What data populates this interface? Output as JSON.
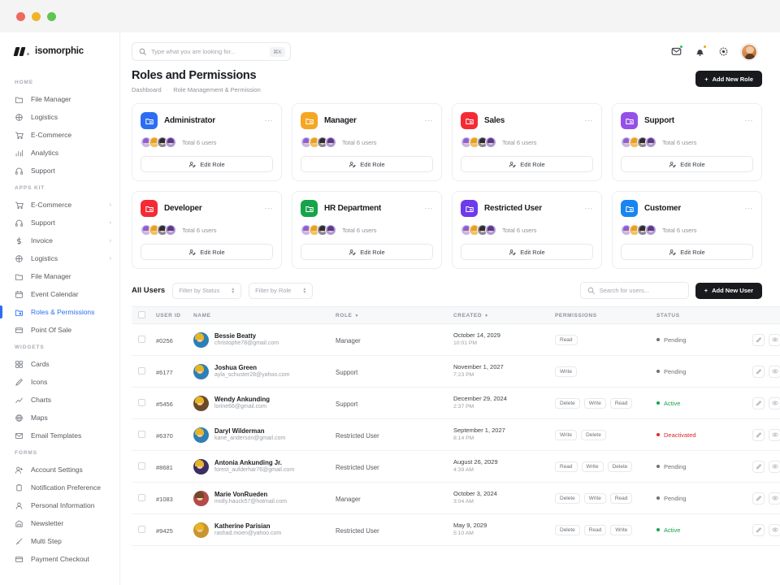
{
  "window": {
    "traffic_lights": [
      "close",
      "minimize",
      "maximize"
    ]
  },
  "brand": {
    "name": "isomorphic"
  },
  "sidebar": {
    "sections": [
      {
        "title": "HOME",
        "items": [
          {
            "label": "File Manager",
            "icon": "file-manager-icon",
            "chevron": false,
            "active": false
          },
          {
            "label": "Logistics",
            "icon": "logistics-icon",
            "chevron": false,
            "active": false
          },
          {
            "label": "E-Commerce",
            "icon": "cart-icon",
            "chevron": false,
            "active": false
          },
          {
            "label": "Analytics",
            "icon": "analytics-icon",
            "chevron": false,
            "active": false
          },
          {
            "label": "Support",
            "icon": "headset-icon",
            "chevron": false,
            "active": false
          }
        ]
      },
      {
        "title": "APPS KIT",
        "items": [
          {
            "label": "E-Commerce",
            "icon": "cart-icon",
            "chevron": true,
            "active": false
          },
          {
            "label": "Support",
            "icon": "headset-icon",
            "chevron": true,
            "active": false
          },
          {
            "label": "Invoice",
            "icon": "dollar-icon",
            "chevron": true,
            "active": false
          },
          {
            "label": "Logistics",
            "icon": "logistics-icon",
            "chevron": true,
            "active": false
          },
          {
            "label": "File Manager",
            "icon": "file-manager-icon",
            "chevron": false,
            "active": false
          },
          {
            "label": "Event Calendar",
            "icon": "calendar-icon",
            "chevron": false,
            "active": false
          },
          {
            "label": "Roles & Permissions",
            "icon": "roles-icon",
            "chevron": false,
            "active": true
          },
          {
            "label": "Point Of Sale",
            "icon": "pos-icon",
            "chevron": false,
            "active": false
          }
        ]
      },
      {
        "title": "WIDGETS",
        "items": [
          {
            "label": "Cards",
            "icon": "cards-icon",
            "chevron": false,
            "active": false
          },
          {
            "label": "Icons",
            "icon": "icons-icon",
            "chevron": false,
            "active": false
          },
          {
            "label": "Charts",
            "icon": "charts-icon",
            "chevron": false,
            "active": false
          },
          {
            "label": "Maps",
            "icon": "maps-icon",
            "chevron": false,
            "active": false
          },
          {
            "label": "Email Templates",
            "icon": "email-icon",
            "chevron": false,
            "active": false
          }
        ]
      },
      {
        "title": "FORMS",
        "items": [
          {
            "label": "Account Settings",
            "icon": "account-settings-icon",
            "chevron": false,
            "active": false
          },
          {
            "label": "Notification Preference",
            "icon": "notification-icon",
            "chevron": false,
            "active": false
          },
          {
            "label": "Personal Information",
            "icon": "person-icon",
            "chevron": false,
            "active": false
          },
          {
            "label": "Newsletter",
            "icon": "newsletter-icon",
            "chevron": false,
            "active": false
          },
          {
            "label": "Multi Step",
            "icon": "multistep-icon",
            "chevron": false,
            "active": false
          },
          {
            "label": "Payment Checkout",
            "icon": "payment-icon",
            "chevron": false,
            "active": false
          }
        ]
      }
    ]
  },
  "topbar": {
    "search": {
      "placeholder": "Type what you are looking for...",
      "shortcut": "⌘K",
      "icon": "search-icon"
    },
    "icons": [
      {
        "name": "messages-icon",
        "badge_color": "#22c55e"
      },
      {
        "name": "bell-icon",
        "badge_color": "#f59e0b"
      },
      {
        "name": "settings-icon",
        "badge_color": ""
      }
    ],
    "avatar": "user-avatar"
  },
  "page": {
    "title": "Roles and Permissions",
    "breadcrumb": {
      "root": "Dashboard",
      "separator": "·",
      "current": "Role Management & Permission"
    },
    "add_role_button": {
      "label": "Add New Role",
      "plus": "+"
    }
  },
  "roles": [
    {
      "name": "Administrator",
      "color": "#2c6ef2",
      "total": "Total 6 users",
      "edit_label": "Edit Role",
      "menu": "···"
    },
    {
      "name": "Manager",
      "color": "#f5a623",
      "total": "Total 6 users",
      "edit_label": "Edit Role",
      "menu": "···"
    },
    {
      "name": "Sales",
      "color": "#f42b35",
      "total": "Total 6 users",
      "edit_label": "Edit Role",
      "menu": "···"
    },
    {
      "name": "Support",
      "color": "#9450e8",
      "total": "Total 6 users",
      "edit_label": "Edit Role",
      "menu": "···"
    },
    {
      "name": "Developer",
      "color": "#f42b35",
      "total": "Total 6 users",
      "edit_label": "Edit Role",
      "menu": "···"
    },
    {
      "name": "HR Department",
      "color": "#17a34a",
      "total": "Total 6 users",
      "edit_label": "Edit Role",
      "menu": "···"
    },
    {
      "name": "Restricted User",
      "color": "#6d3aec",
      "total": "Total 6 users",
      "edit_label": "Edit Role",
      "menu": "···"
    },
    {
      "name": "Customer",
      "color": "#1886f0",
      "total": "Total 6 users",
      "edit_label": "Edit Role",
      "menu": "···"
    }
  ],
  "users_section": {
    "title": "All Users",
    "filter_status": {
      "label": "Filter by Status"
    },
    "filter_role": {
      "label": "Filter by Role"
    },
    "search": {
      "placeholder": "Search for users...",
      "icon": "search-icon"
    },
    "add_user_button": {
      "label": "Add New User",
      "plus": "+"
    }
  },
  "table": {
    "columns": [
      {
        "key": "checkbox",
        "label": ""
      },
      {
        "key": "user_id",
        "label": "USER ID",
        "sortable": false
      },
      {
        "key": "name",
        "label": "NAME",
        "sortable": false
      },
      {
        "key": "role",
        "label": "ROLE",
        "sortable": true
      },
      {
        "key": "created",
        "label": "CREATED",
        "sortable": true
      },
      {
        "key": "permissions",
        "label": "PERMISSIONS",
        "sortable": false
      },
      {
        "key": "status",
        "label": "STATUS",
        "sortable": false
      },
      {
        "key": "actions",
        "label": ""
      }
    ],
    "status_colors": {
      "Pending": "#6b7077",
      "Active": "#17a34a",
      "Deactivated": "#e0262d"
    },
    "row_actions": [
      {
        "name": "edit-row-icon"
      },
      {
        "name": "view-row-icon"
      },
      {
        "name": "delete-row-icon"
      }
    ],
    "rows": [
      {
        "user_id": "#0256",
        "name": "Bessie Beatty",
        "email": "christophe78@gmail.com",
        "role": "Manager",
        "date": "October 14, 2029",
        "time": "10:01 PM",
        "permissions": [
          "Read"
        ],
        "status": "Pending",
        "av_hair": "#e8b424",
        "av_body": "#2f7fb5"
      },
      {
        "user_id": "#6177",
        "name": "Joshua Green",
        "email": "ayla_schuster28@yahoo.com",
        "role": "Support",
        "date": "November 1, 2027",
        "time": "7:23 PM",
        "permissions": [
          "Write"
        ],
        "status": "Pending",
        "av_hair": "#e8b424",
        "av_body": "#2f7fb5"
      },
      {
        "user_id": "#5456",
        "name": "Wendy Ankunding",
        "email": "lorine66@gmail.com",
        "role": "Support",
        "date": "December 29, 2024",
        "time": "2:37 PM",
        "permissions": [
          "Delete",
          "Write",
          "Read"
        ],
        "status": "Active",
        "av_hair": "#e8b424",
        "av_body": "#6b4a2a"
      },
      {
        "user_id": "#6370",
        "name": "Daryl Wilderman",
        "email": "kane_anderson@gmail.com",
        "role": "Restricted User",
        "date": "September 1, 2027",
        "time": "8:14 PM",
        "permissions": [
          "Write",
          "Delete"
        ],
        "status": "Deactivated",
        "av_hair": "#e8b424",
        "av_body": "#2f7fb5"
      },
      {
        "user_id": "#8681",
        "name": "Antonia Ankunding Jr.",
        "email": "forest_aufderhar76@gmail.com",
        "role": "Restricted User",
        "date": "August 26, 2029",
        "time": "4:39 AM",
        "permissions": [
          "Read",
          "Write",
          "Delete"
        ],
        "status": "Pending",
        "av_hair": "#e8b424",
        "av_body": "#3b2f63"
      },
      {
        "user_id": "#1083",
        "name": "Marie VonRueden",
        "email": "molly.hauck57@hotmail.com",
        "role": "Manager",
        "date": "October 3, 2024",
        "time": "3:04 AM",
        "permissions": [
          "Delete",
          "Write",
          "Read"
        ],
        "status": "Pending",
        "av_hair": "#6b4a2a",
        "av_body": "#b44a4a"
      },
      {
        "user_id": "#9425",
        "name": "Katherine Parisian",
        "email": "rashad.moen@yahoo.com",
        "role": "Restricted User",
        "date": "May 9, 2029",
        "time": "5:10 AM",
        "permissions": [
          "Delete",
          "Read",
          "Write"
        ],
        "status": "Active",
        "av_hair": "#e8b424",
        "av_body": "#c9952f"
      }
    ]
  }
}
